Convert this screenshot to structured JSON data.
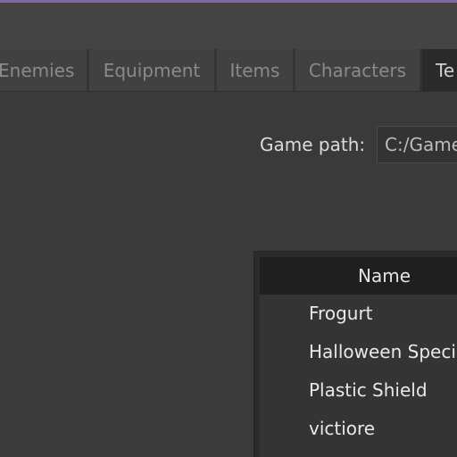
{
  "tabs": [
    {
      "label": "Enemies",
      "active": false
    },
    {
      "label": "Equipment",
      "active": false
    },
    {
      "label": "Items",
      "active": false
    },
    {
      "label": "Characters",
      "active": false
    },
    {
      "label": "Te",
      "active": true
    }
  ],
  "game_path": {
    "label": "Game path:",
    "value": "C:/Game"
  },
  "list": {
    "header": "Name",
    "rows": [
      "Frogurt",
      "Halloween Speci",
      "Plastic Shield",
      "victiore"
    ]
  },
  "colors": {
    "accent": "#7e6aa0",
    "background": "#3a3a3a",
    "list_header": "#1f1f1f"
  }
}
